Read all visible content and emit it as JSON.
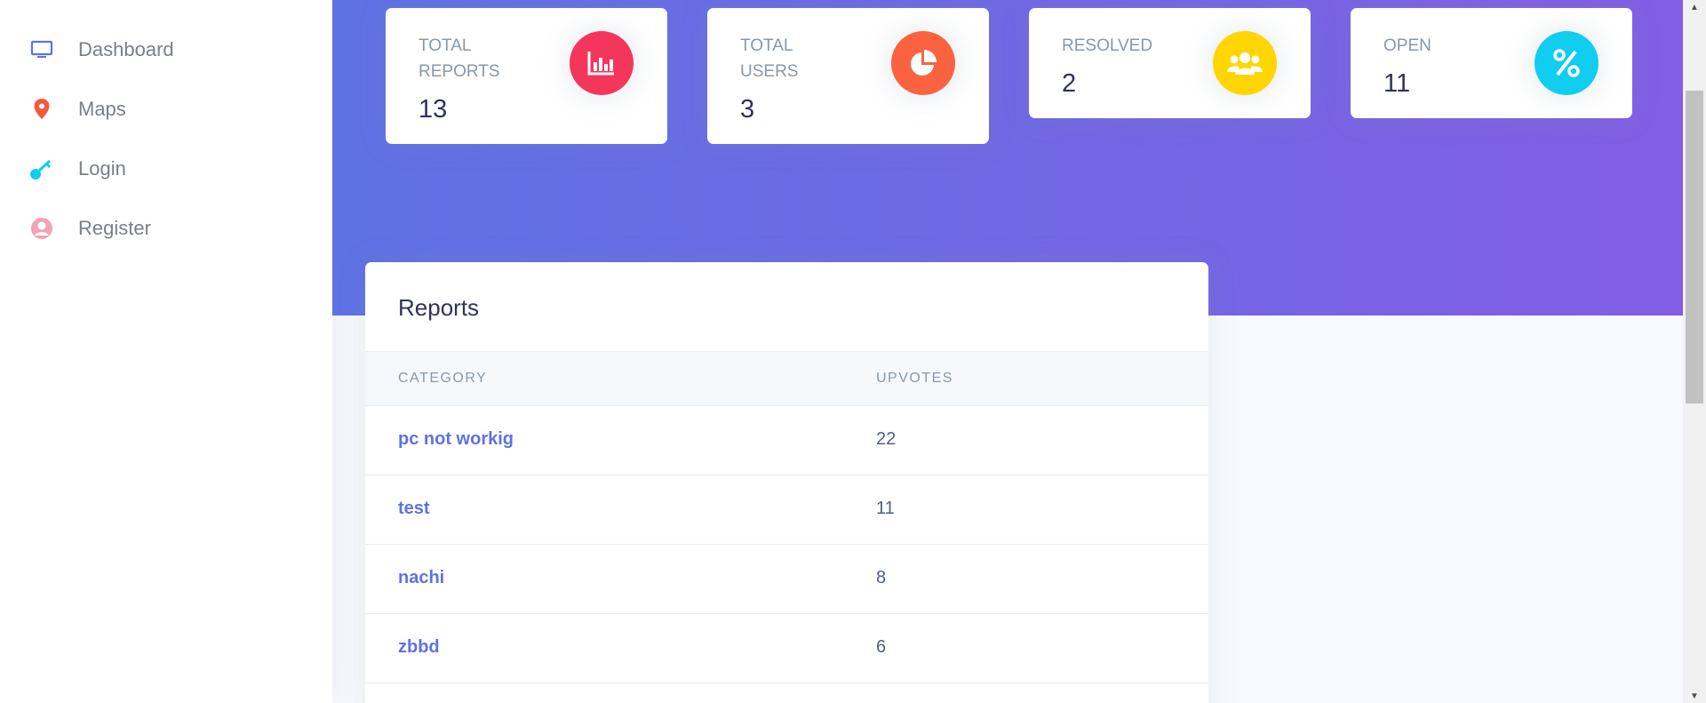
{
  "sidebar": {
    "items": [
      {
        "label": "Dashboard",
        "icon": "monitor-icon",
        "color": "#5e72e4"
      },
      {
        "label": "Maps",
        "icon": "map-pin-icon",
        "color": "#f5593d"
      },
      {
        "label": "Login",
        "icon": "key-icon",
        "color": "#11cdef"
      },
      {
        "label": "Register",
        "icon": "user-circle-icon",
        "color": "#f3a4b5"
      }
    ]
  },
  "stats": [
    {
      "title": "TOTAL REPORTS",
      "value": "13",
      "icon": "bar-chart-icon",
      "color": "#f5365c"
    },
    {
      "title": "TOTAL USERS",
      "value": "3",
      "icon": "pie-chart-icon",
      "color": "#fb6340"
    },
    {
      "title": "RESOLVED",
      "value": "2",
      "icon": "users-icon",
      "color": "#ffd600"
    },
    {
      "title": "OPEN",
      "value": "11",
      "icon": "percent-icon",
      "color": "#11cdef"
    }
  ],
  "reports": {
    "title": "Reports",
    "columns": [
      "CATEGORY",
      "UPVOTES"
    ],
    "rows": [
      {
        "category": "pc not workig",
        "upvotes": "22"
      },
      {
        "category": "test",
        "upvotes": "11"
      },
      {
        "category": "nachi",
        "upvotes": "8"
      },
      {
        "category": "zbbd",
        "upvotes": "6"
      }
    ]
  },
  "colors": {
    "gradient_start": "#5e72e4",
    "gradient_end": "#825ee4",
    "link": "#5e72e4"
  }
}
